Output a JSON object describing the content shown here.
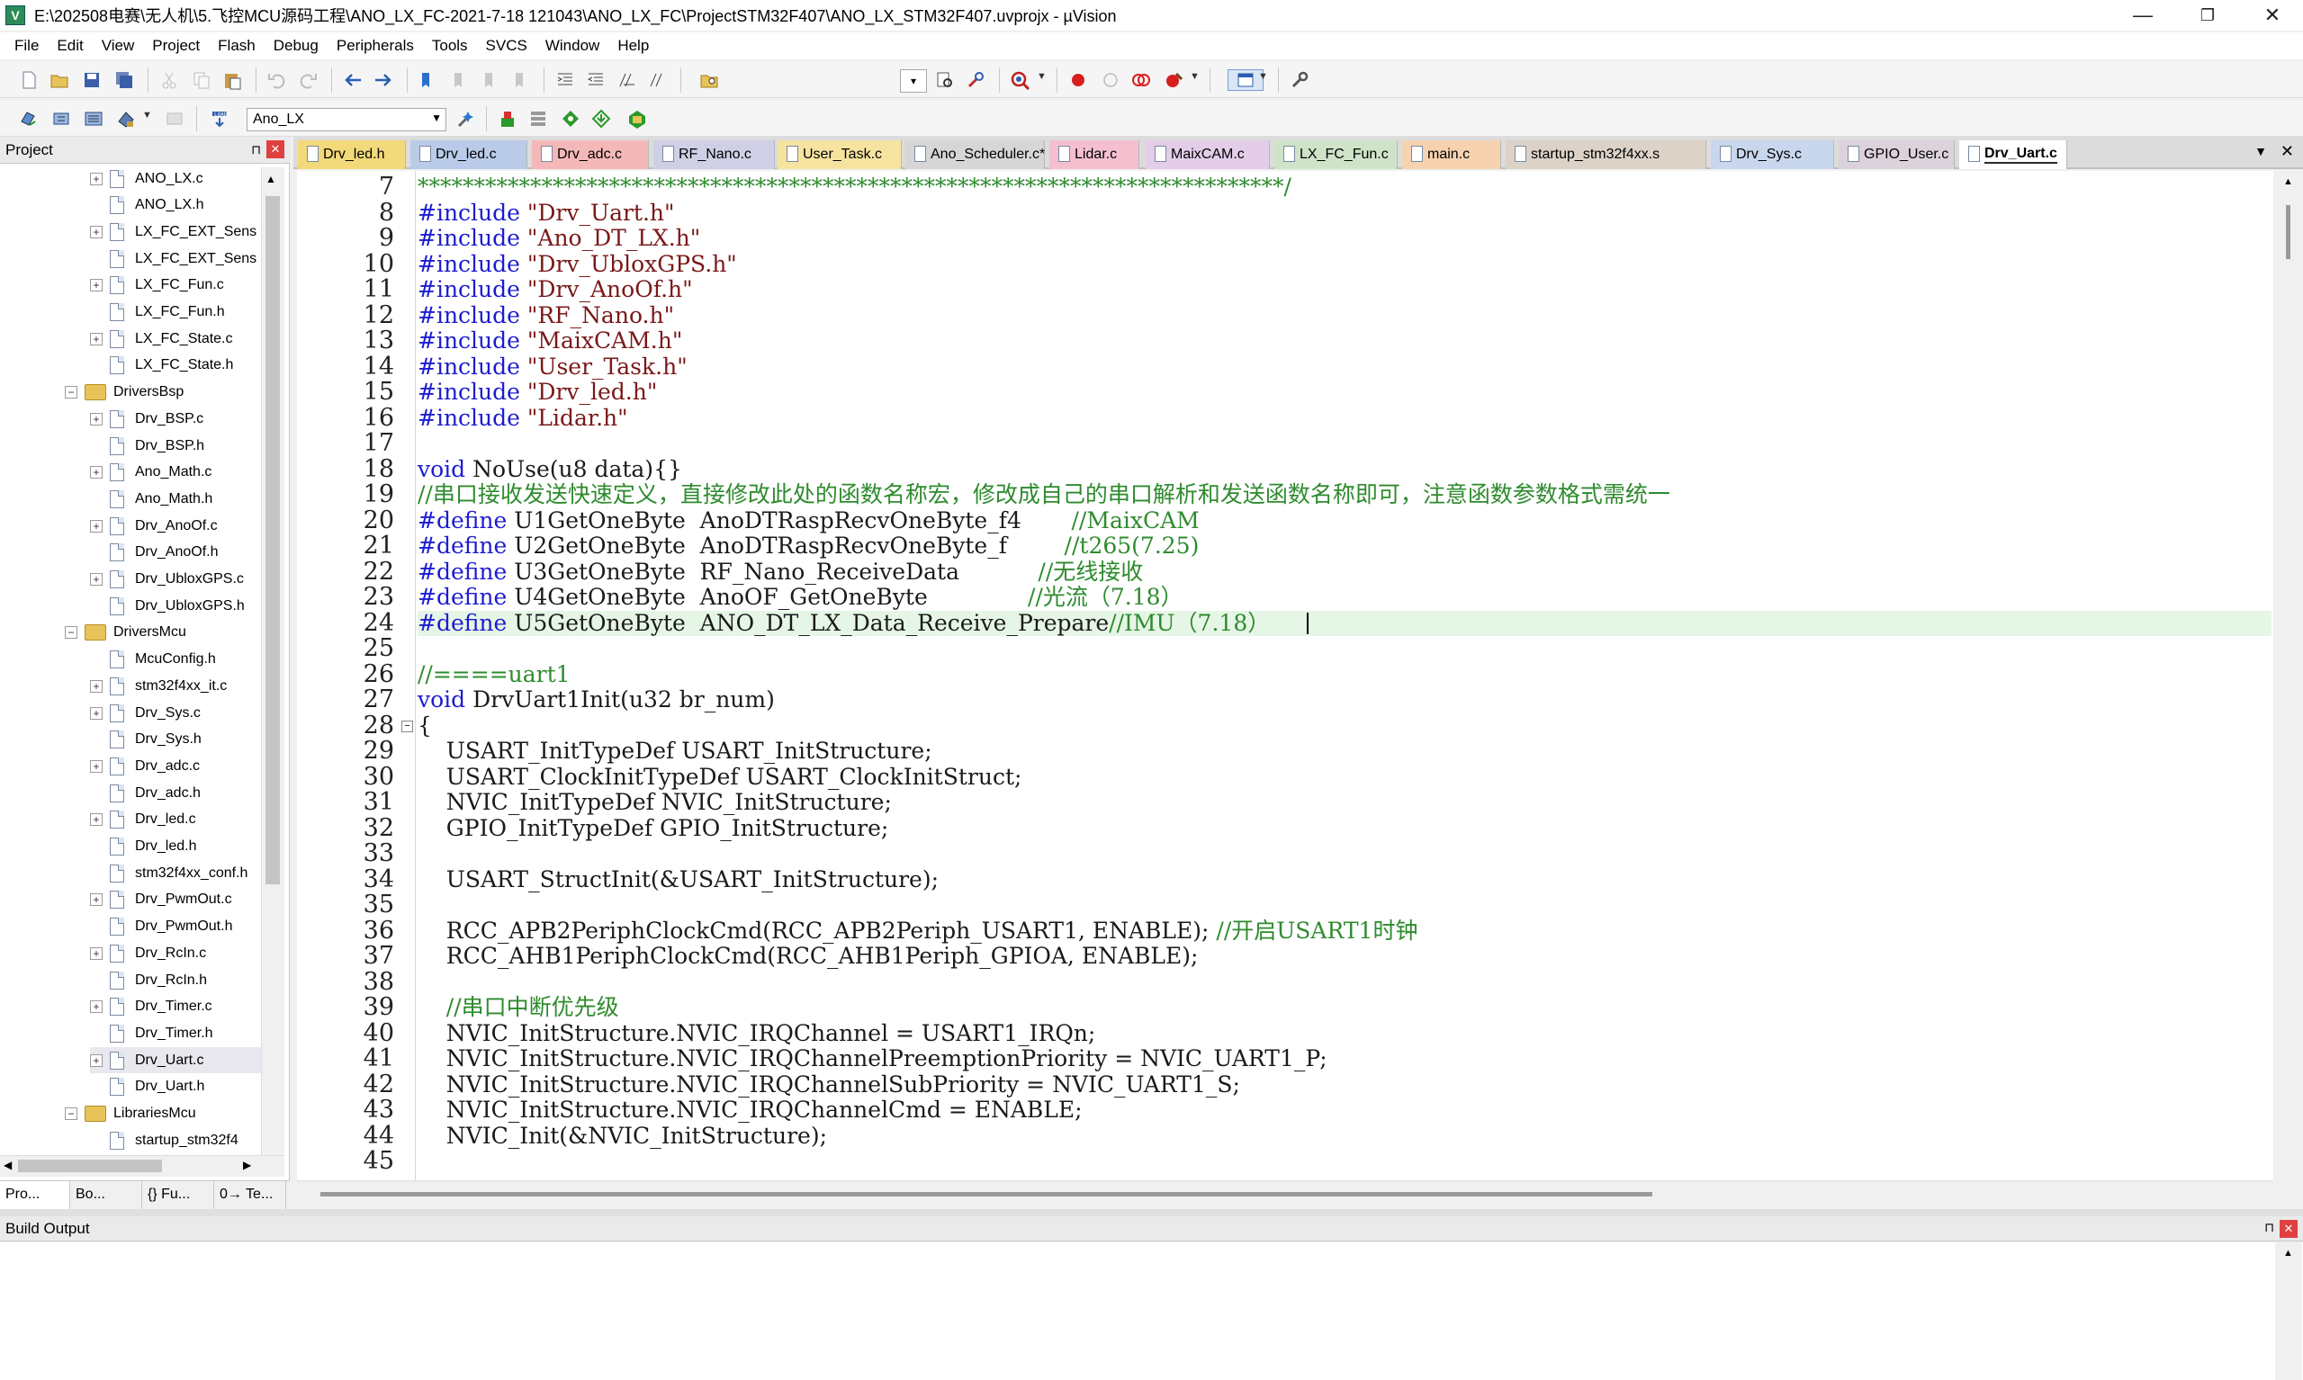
{
  "window": {
    "title": "E:\\202508电赛\\无人机\\5.飞控MCU源码工程\\ANO_LX_FC-2021-7-18 121043\\ANO_LX_FC\\ProjectSTM32F407\\ANO_LX_STM32F407.uvprojx - µVision",
    "app_icon_letter": "V",
    "minimize": "—",
    "maximize": "❐",
    "close": "✕"
  },
  "menu": [
    "File",
    "Edit",
    "View",
    "Project",
    "Flash",
    "Debug",
    "Peripherals",
    "Tools",
    "SVCS",
    "Window",
    "Help"
  ],
  "toolbar2": {
    "target": "Ano_LX"
  },
  "project_pane": {
    "title": "Project",
    "pin": "⊓",
    "close": "✕",
    "tree": [
      {
        "label": "ANO_LX.c",
        "level": 2,
        "expander": "+"
      },
      {
        "label": "ANO_LX.h",
        "level": 2,
        "expander": ""
      },
      {
        "label": "LX_FC_EXT_Sens",
        "level": 2,
        "expander": "+"
      },
      {
        "label": "LX_FC_EXT_Sens",
        "level": 2,
        "expander": ""
      },
      {
        "label": "LX_FC_Fun.c",
        "level": 2,
        "expander": "+"
      },
      {
        "label": "LX_FC_Fun.h",
        "level": 2,
        "expander": ""
      },
      {
        "label": "LX_FC_State.c",
        "level": 2,
        "expander": "+"
      },
      {
        "label": "LX_FC_State.h",
        "level": 2,
        "expander": ""
      },
      {
        "label": "DriversBsp",
        "level": 1,
        "expander": "−",
        "folder": true
      },
      {
        "label": "Drv_BSP.c",
        "level": 2,
        "expander": "+"
      },
      {
        "label": "Drv_BSP.h",
        "level": 2,
        "expander": ""
      },
      {
        "label": "Ano_Math.c",
        "level": 2,
        "expander": "+"
      },
      {
        "label": "Ano_Math.h",
        "level": 2,
        "expander": ""
      },
      {
        "label": "Drv_AnoOf.c",
        "level": 2,
        "expander": "+"
      },
      {
        "label": "Drv_AnoOf.h",
        "level": 2,
        "expander": ""
      },
      {
        "label": "Drv_UbloxGPS.c",
        "level": 2,
        "expander": "+"
      },
      {
        "label": "Drv_UbloxGPS.h",
        "level": 2,
        "expander": ""
      },
      {
        "label": "DriversMcu",
        "level": 1,
        "expander": "−",
        "folder": true
      },
      {
        "label": "McuConfig.h",
        "level": 2,
        "expander": ""
      },
      {
        "label": "stm32f4xx_it.c",
        "level": 2,
        "expander": "+"
      },
      {
        "label": "Drv_Sys.c",
        "level": 2,
        "expander": "+"
      },
      {
        "label": "Drv_Sys.h",
        "level": 2,
        "expander": ""
      },
      {
        "label": "Drv_adc.c",
        "level": 2,
        "expander": "+"
      },
      {
        "label": "Drv_adc.h",
        "level": 2,
        "expander": ""
      },
      {
        "label": "Drv_led.c",
        "level": 2,
        "expander": "+"
      },
      {
        "label": "Drv_led.h",
        "level": 2,
        "expander": ""
      },
      {
        "label": "stm32f4xx_conf.h",
        "level": 2,
        "expander": ""
      },
      {
        "label": "Drv_PwmOut.c",
        "level": 2,
        "expander": "+"
      },
      {
        "label": "Drv_PwmOut.h",
        "level": 2,
        "expander": ""
      },
      {
        "label": "Drv_RcIn.c",
        "level": 2,
        "expander": "+"
      },
      {
        "label": "Drv_RcIn.h",
        "level": 2,
        "expander": ""
      },
      {
        "label": "Drv_Timer.c",
        "level": 2,
        "expander": "+"
      },
      {
        "label": "Drv_Timer.h",
        "level": 2,
        "expander": ""
      },
      {
        "label": "Drv_Uart.c",
        "level": 2,
        "expander": "+",
        "selected": true
      },
      {
        "label": "Drv_Uart.h",
        "level": 2,
        "expander": ""
      },
      {
        "label": "LibrariesMcu",
        "level": 1,
        "expander": "−",
        "folder": true
      },
      {
        "label": "startup_stm32f4",
        "level": 2,
        "expander": ""
      }
    ],
    "tabs": [
      "Pro...",
      "Bo...",
      "{} Fu...",
      "0→ Te..."
    ]
  },
  "editor_tabs": [
    {
      "label": "Drv_led.h",
      "color": "#f2d97a"
    },
    {
      "label": "Drv_led.c",
      "color": "#b9cbe8"
    },
    {
      "label": "Drv_adc.c",
      "color": "#f4b8b8"
    },
    {
      "label": "RF_Nano.c",
      "color": "#cfcfe6"
    },
    {
      "label": "User_Task.c",
      "color": "#f6e3a0"
    },
    {
      "label": "Ano_Scheduler.c*",
      "color": "#d6d6d6"
    },
    {
      "label": "Lidar.c",
      "color": "#f4c0d0"
    },
    {
      "label": "MaixCAM.c",
      "color": "#e3cde8"
    },
    {
      "label": "LX_FC_Fun.c",
      "color": "#cfe3c8"
    },
    {
      "label": "main.c",
      "color": "#f6d2b0"
    },
    {
      "label": "startup_stm32f4xx.s",
      "color": "#dcd2c8"
    },
    {
      "label": "Drv_Sys.c",
      "color": "#c9d7ee"
    },
    {
      "label": "GPIO_User.c",
      "color": "#dcd2dc"
    },
    {
      "label": "Drv_Uart.c",
      "color": "#ffffff",
      "active": true
    }
  ],
  "tabstrip_controls": {
    "menu": "▼",
    "close": "✕"
  },
  "editor": {
    "lines": [
      {
        "n": "7",
        "t": "*****************************************************************************/",
        "c": "cmt"
      },
      {
        "n": "8",
        "t": "#include \"Drv_Uart.h\"",
        "c": "inc"
      },
      {
        "n": "9",
        "t": "#include \"Ano_DT_LX.h\"",
        "c": "inc"
      },
      {
        "n": "10",
        "t": "#include \"Drv_UbloxGPS.h\"",
        "c": "inc"
      },
      {
        "n": "11",
        "t": "#include \"Drv_AnoOf.h\"",
        "c": "inc"
      },
      {
        "n": "12",
        "t": "#include \"RF_Nano.h\"",
        "c": "inc"
      },
      {
        "n": "13",
        "t": "#include \"MaixCAM.h\"",
        "c": "inc"
      },
      {
        "n": "14",
        "t": "#include \"User_Task.h\"",
        "c": "inc"
      },
      {
        "n": "15",
        "t": "#include \"Drv_led.h\"",
        "c": "inc"
      },
      {
        "n": "16",
        "t": "#include \"Lidar.h\"",
        "c": "inc"
      },
      {
        "n": "17",
        "t": "",
        "c": "plain"
      },
      {
        "n": "18",
        "t": "void NoUse(u8 data){}",
        "c": "void"
      },
      {
        "n": "19",
        "t": "//串口接收发送快速定义，直接修改此处的函数名称宏，修改成自己的串口解析和发送函数名称即可，注意函数参数格式需统一",
        "c": "cmt"
      },
      {
        "n": "20",
        "t": "#define U1GetOneByte  AnoDTRaspRecvOneByte_f4       ",
        "cm": "//MaixCAM",
        "c": "def"
      },
      {
        "n": "21",
        "t": "#define U2GetOneByte  AnoDTRaspRecvOneByte_f        ",
        "cm": "//t265(7.25)",
        "c": "def"
      },
      {
        "n": "22",
        "t": "#define U3GetOneByte  RF_Nano_ReceiveData           ",
        "cm": "//无线接收",
        "c": "def"
      },
      {
        "n": "23",
        "t": "#define U4GetOneByte  AnoOF_GetOneByte              ",
        "cm": "//光流（7.18）",
        "c": "def"
      },
      {
        "n": "24",
        "t": "#define U5GetOneByte  ANO_DT_LX_Data_Receive_Prepare",
        "cm": "//IMU（7.18）",
        "c": "def"
      },
      {
        "n": "25",
        "t": "",
        "c": "plain"
      },
      {
        "n": "26",
        "t": "//====uart1",
        "c": "cmt"
      },
      {
        "n": "27",
        "t": "void DrvUart1Init(u32 br_num)",
        "c": "void"
      },
      {
        "n": "28",
        "t": "{",
        "c": "plain"
      },
      {
        "n": "29",
        "t": "    USART_InitTypeDef USART_InitStructure;",
        "c": "plain"
      },
      {
        "n": "30",
        "t": "    USART_ClockInitTypeDef USART_ClockInitStruct;",
        "c": "plain"
      },
      {
        "n": "31",
        "t": "    NVIC_InitTypeDef NVIC_InitStructure;",
        "c": "plain"
      },
      {
        "n": "32",
        "t": "    GPIO_InitTypeDef GPIO_InitStructure;",
        "c": "plain"
      },
      {
        "n": "33",
        "t": "",
        "c": "plain"
      },
      {
        "n": "34",
        "t": "    USART_StructInit(&USART_InitStructure);",
        "c": "plain"
      },
      {
        "n": "35",
        "t": "",
        "c": "plain"
      },
      {
        "n": "36",
        "t": "    RCC_APB2PeriphClockCmd(RCC_APB2Periph_USART1, ENABLE); ",
        "cm": "//开启USART1时钟",
        "c": "def2"
      },
      {
        "n": "37",
        "t": "    RCC_AHB1PeriphClockCmd(RCC_AHB1Periph_GPIOA, ENABLE);",
        "c": "plain"
      },
      {
        "n": "38",
        "t": "",
        "c": "plain"
      },
      {
        "n": "39",
        "t": "    //串口中断优先级",
        "c": "cmt"
      },
      {
        "n": "40",
        "t": "    NVIC_InitStructure.NVIC_IRQChannel = USART1_IRQn;",
        "c": "plain"
      },
      {
        "n": "41",
        "t": "    NVIC_InitStructure.NVIC_IRQChannelPreemptionPriority = NVIC_UART1_P;",
        "c": "plain"
      },
      {
        "n": "42",
        "t": "    NVIC_InitStructure.NVIC_IRQChannelSubPriority = NVIC_UART1_S;",
        "c": "plain"
      },
      {
        "n": "43",
        "t": "    NVIC_InitStructure.NVIC_IRQChannelCmd = ENABLE;",
        "c": "plain"
      },
      {
        "n": "44",
        "t": "    NVIC_Init(&NVIC_InitStructure);",
        "c": "plain"
      },
      {
        "n": "45",
        "t": "",
        "c": "plain"
      }
    ],
    "current_line": "24"
  },
  "build_output": {
    "title": "Build Output",
    "pin": "⊓",
    "close": "✕"
  }
}
